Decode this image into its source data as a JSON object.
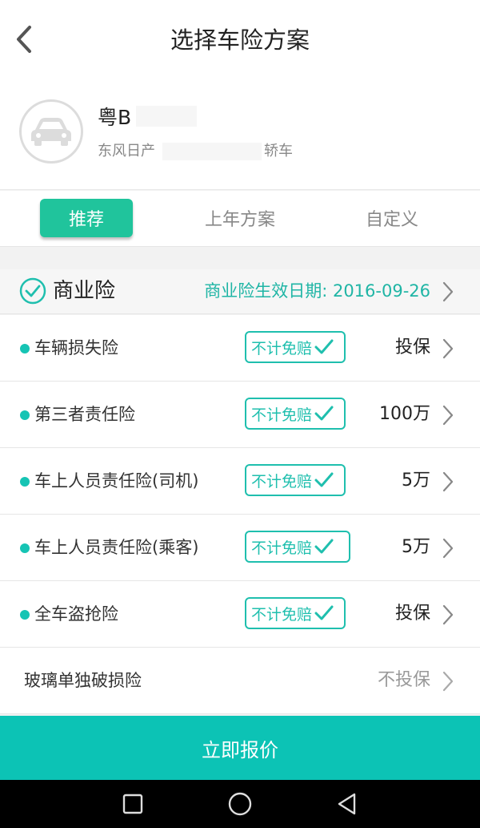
{
  "header": {
    "title": "选择车险方案"
  },
  "car": {
    "plate": "粤B",
    "model_prefix": "东风日产",
    "model_suffix": "轿车"
  },
  "tabs": [
    {
      "label": "推荐",
      "active": true
    },
    {
      "label": "上年方案",
      "active": false
    },
    {
      "label": "自定义",
      "active": false
    }
  ],
  "section": {
    "title": "商业险",
    "effective_date": "商业险生效日期: 2016-09-26"
  },
  "rows": [
    {
      "label": "车辆损失险",
      "badge": "不计免赔",
      "value": "投保"
    },
    {
      "label": "第三者责任险",
      "badge": "不计免赔",
      "value": "100万"
    },
    {
      "label": "车上人员责任险(司机)",
      "badge": "不计免赔",
      "value": "5万"
    },
    {
      "label": "车上人员责任险(乘客)",
      "badge": "不计免赔",
      "value": "5万"
    },
    {
      "label": "全车盗抢险",
      "badge": "不计免赔",
      "value": "投保"
    },
    {
      "label": "玻璃单独破损险",
      "badge": "",
      "value": "不投保"
    }
  ],
  "footer": {
    "quote_button": "立即报价"
  },
  "colors": {
    "accent": "#20c49c",
    "teal_text": "#1fb5a5",
    "button": "#0cc3b5"
  },
  "icons": {
    "back": "chevron-left-icon",
    "car": "car-icon",
    "check": "check-circle-icon",
    "chevron": "chevron-right-icon",
    "nav_recent": "square-icon",
    "nav_home": "circle-icon",
    "nav_back": "triangle-back-icon"
  }
}
